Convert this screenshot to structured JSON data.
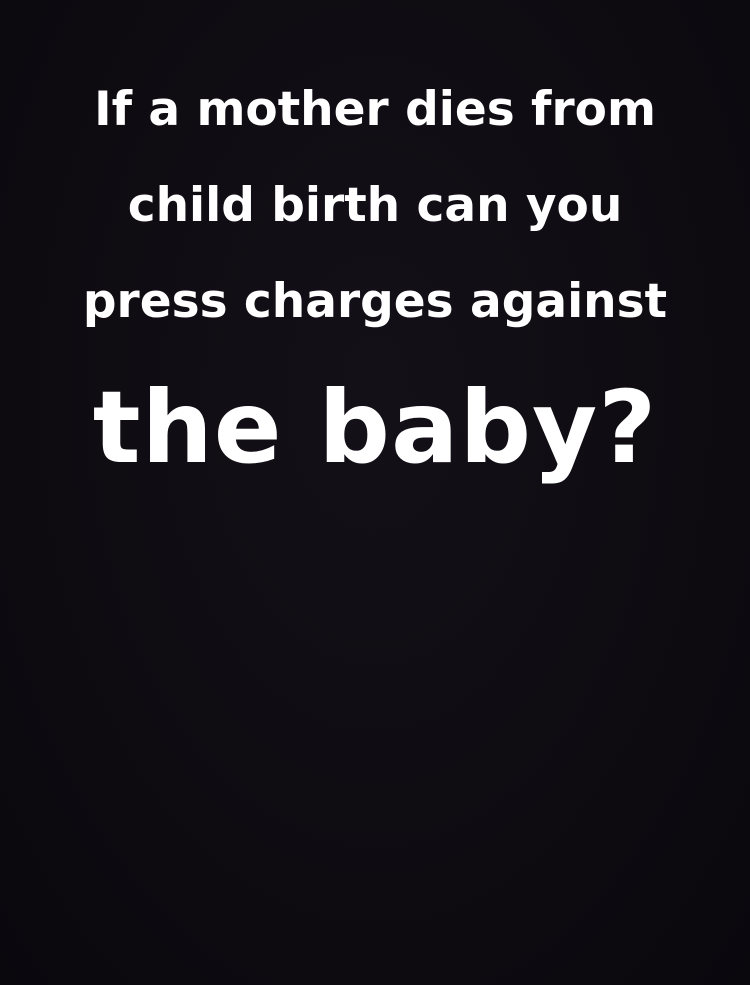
{
  "background_color": "#0f0c12",
  "text_color": "#ffffff",
  "caption": {
    "line1": "If a mother dies from",
    "line2": "child birth can you",
    "line3": "press charges against",
    "emphasis": "the baby?"
  }
}
